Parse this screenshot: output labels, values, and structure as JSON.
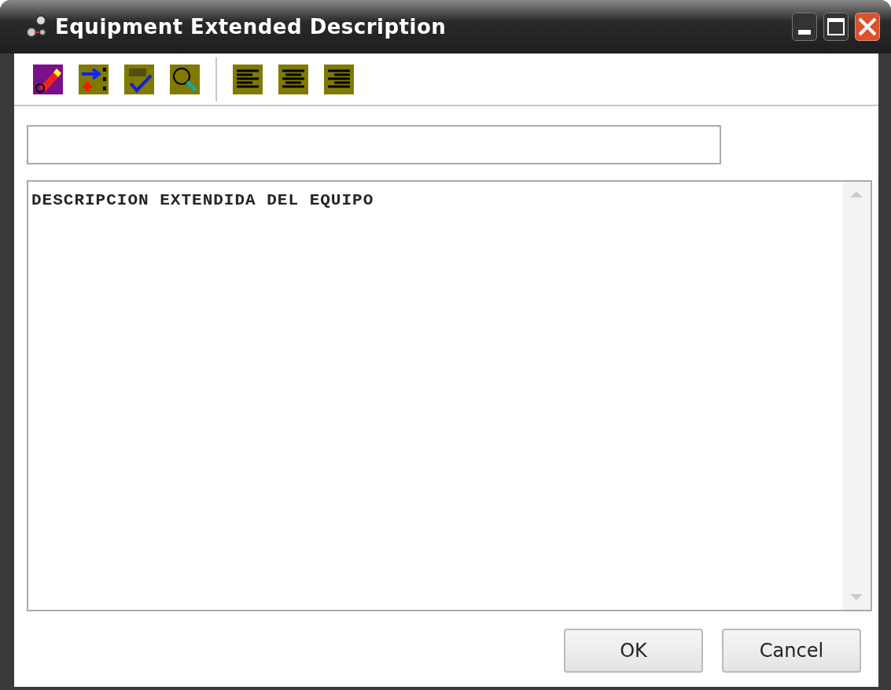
{
  "window": {
    "title": "Equipment Extended Description"
  },
  "description": {
    "text": "DESCRIPCION EXTENDIDA DEL EQUIPO"
  },
  "buttons": [
    "OK",
    "Cancel"
  ]
}
